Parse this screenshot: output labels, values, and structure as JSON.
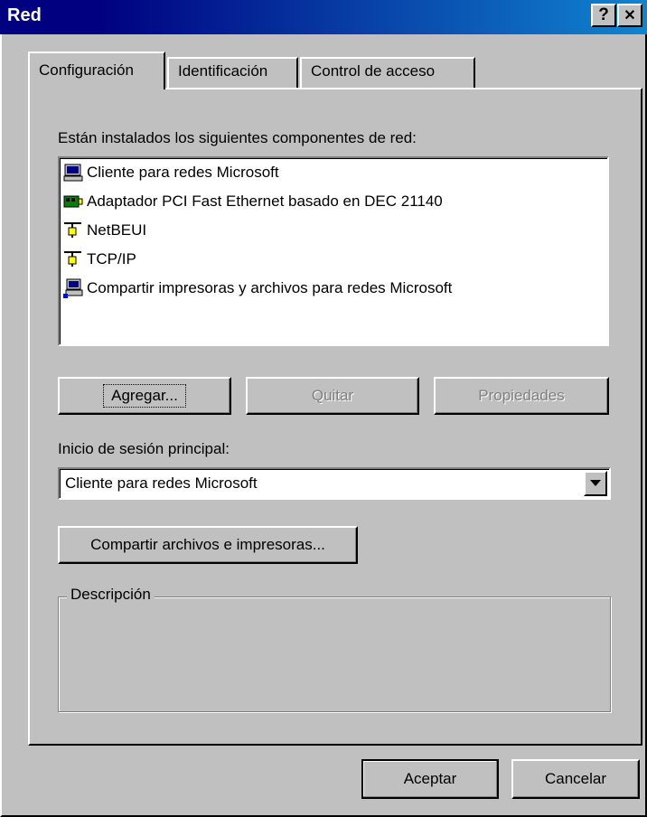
{
  "window": {
    "title": "Red",
    "help_button": "?",
    "close_button": "✕"
  },
  "tabs": [
    {
      "label": "Configuración",
      "active": true
    },
    {
      "label": "Identificación",
      "active": false
    },
    {
      "label": "Control de acceso",
      "active": false
    }
  ],
  "components": {
    "heading": "Están instalados los siguientes componentes de red:",
    "items": [
      {
        "label": "Cliente para redes Microsoft",
        "icon": "network-client-icon"
      },
      {
        "label": "Adaptador PCI Fast Ethernet basado en DEC 21140",
        "icon": "network-adapter-icon"
      },
      {
        "label": "NetBEUI",
        "icon": "protocol-icon"
      },
      {
        "label": "TCP/IP",
        "icon": "protocol-icon"
      },
      {
        "label": "Compartir impresoras y archivos para redes Microsoft",
        "icon": "file-printer-sharing-icon"
      }
    ]
  },
  "buttons": {
    "add": "Agregar...",
    "remove": "Quitar",
    "properties": "Propiedades",
    "sharing": "Compartir archivos e impresoras...",
    "ok": "Aceptar",
    "cancel": "Cancelar"
  },
  "logon": {
    "label": "Inicio de sesión principal:",
    "selected": "Cliente para redes Microsoft"
  },
  "description": {
    "legend": "Descripción",
    "text": ""
  },
  "colors": {
    "titlebar_start": "#000080",
    "titlebar_end": "#1084d0",
    "face": "#c0c0c0"
  }
}
